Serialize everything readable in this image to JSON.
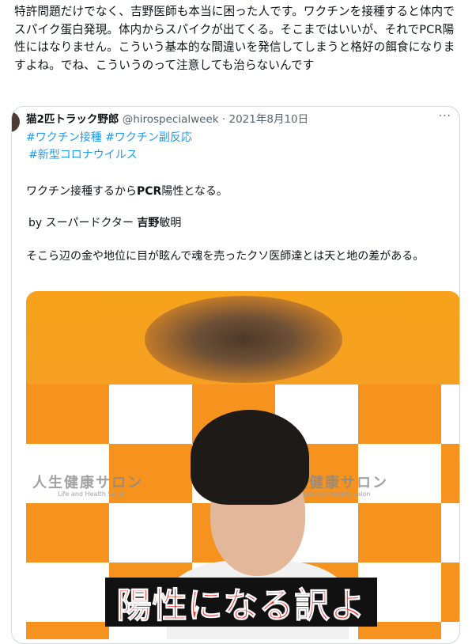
{
  "tweet": {
    "text": "特許問題だけでなく、吉野医師も本当に困った人です。ワクチンを接種すると体内でスパイク蛋白発現。体内からスパイクが出てくる。そこまではいいが、それでPCR陽性にはなりません。こういう基本的な間違いを発信してしまうと格好の餌食になりますよね。でね、こういうのって注意しても治らないんです"
  },
  "quoted": {
    "author": "猫2匹トラック野郎",
    "handle": "@hirospecialweek",
    "separator": "·",
    "date": "2021年8月10日",
    "hashtags": [
      "#ワクチン接種",
      "#ワクチン副反応",
      "#新型コロナウイルス"
    ],
    "line1_pre": "ワクチン接種するから",
    "line1_bold": "PCR",
    "line1_post": "陽性となる。",
    "line2_pre": "by スーパードクター ",
    "line2_bold": "吉野",
    "line2_post": "敏明",
    "line3": "そこら辺の金や地位に目が眩んで魂を売ったクソ医師達とは天と地の差がある。",
    "more_glyph": "···"
  },
  "media": {
    "caption": "陽性になる訳よ",
    "logo_text": "人生健康サロン",
    "logo_sub": "Life and Health Salon"
  },
  "colors": {
    "link": "#1d9bf0",
    "secondary": "#536471",
    "border": "#cfd9de",
    "orange": "#f6921e",
    "caption_text": "#ff2020"
  }
}
